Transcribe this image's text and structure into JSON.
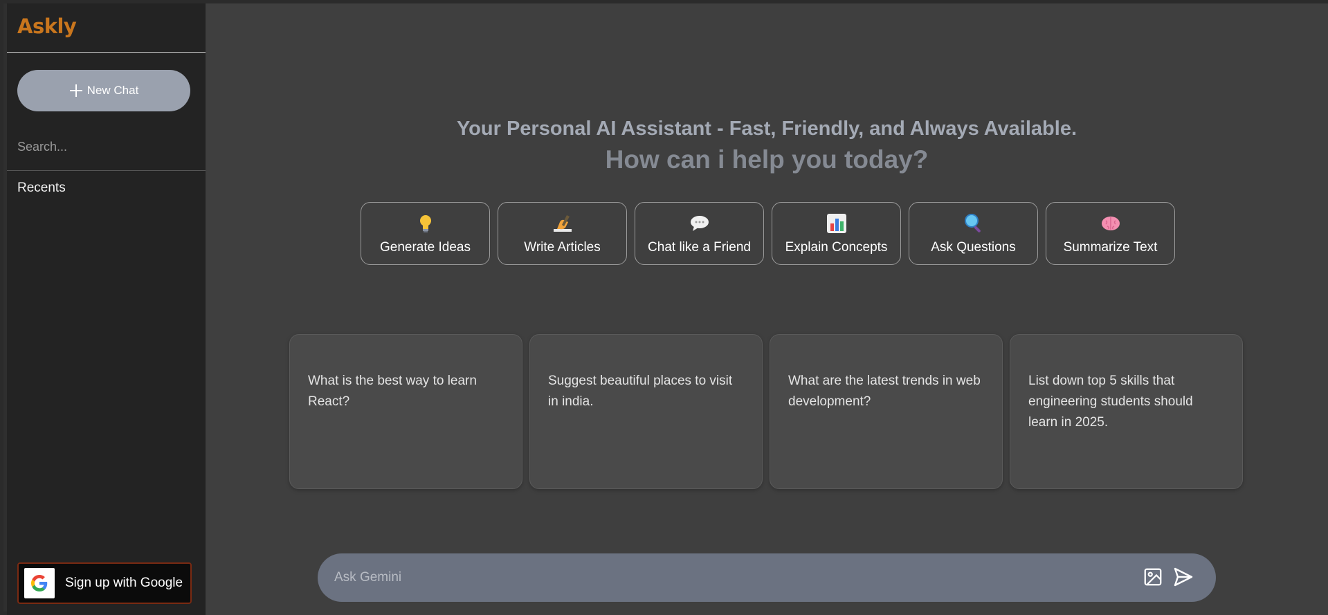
{
  "app": {
    "name": "Askly",
    "brand_color": "#c9761d"
  },
  "sidebar": {
    "new_chat_label": "New Chat",
    "search_placeholder": "Search...",
    "recents_label": "Recents",
    "google_signup_label": "Sign up with Google"
  },
  "hero": {
    "tagline": "Your Personal AI Assistant - Fast, Friendly, and Always Available.",
    "headline": "How can i help you today?"
  },
  "chips": [
    {
      "icon": "lightbulb-icon",
      "label": "Generate Ideas"
    },
    {
      "icon": "writing-hand-icon",
      "label": "Write Articles"
    },
    {
      "icon": "speech-bubble-icon",
      "label": "Chat like a Friend"
    },
    {
      "icon": "bar-chart-icon",
      "label": "Explain Concepts"
    },
    {
      "icon": "magnifier-icon",
      "label": "Ask Questions"
    },
    {
      "icon": "brain-icon",
      "label": "Summarize Text"
    }
  ],
  "suggestions": [
    {
      "text": "What is the best way to learn React?"
    },
    {
      "text": "Suggest beautiful places to visit in india."
    },
    {
      "text": "What are the latest trends in web development?"
    },
    {
      "text": "List down top 5 skills that engineering students should learn in 2025."
    }
  ],
  "composer": {
    "placeholder": "Ask Gemini",
    "image_icon": "image-icon",
    "send_icon": "send-icon"
  }
}
